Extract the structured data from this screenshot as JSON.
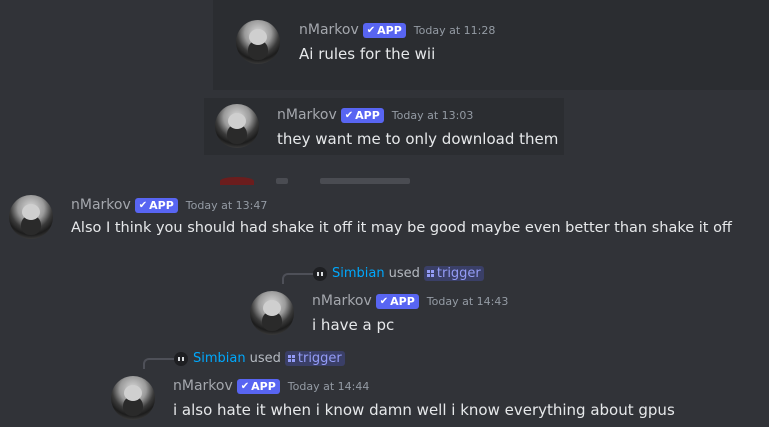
{
  "colors": {
    "background": "#313338",
    "badge": "#5865f2",
    "bot_name": "#00a8fc",
    "command": "#949cf7"
  },
  "messages": [
    {
      "username": "nMarkov",
      "badge": "APP",
      "timestamp": "Today at 11:28",
      "content": "Ai rules for the wii"
    },
    {
      "username": "nMarkov",
      "badge": "APP",
      "timestamp": "Today at 13:03",
      "content": "they want me to only download them"
    },
    {
      "username": "nMarkov",
      "badge": "APP",
      "timestamp": "Today at 13:47",
      "content": "Also I think you should had shake it off it may be good maybe even better than shake it off"
    },
    {
      "username": "nMarkov",
      "badge": "APP",
      "timestamp": "Today at 14:43",
      "content": "i have a pc",
      "reply": {
        "bot": "Simbian",
        "used": "used",
        "command": "trigger",
        "bot_icon": "robot-icon",
        "command_icon": "slash-command-icon"
      }
    },
    {
      "username": "nMarkov",
      "badge": "APP",
      "timestamp": "Today at 14:44",
      "content": "i also hate it when i know damn well i know everything about gpus",
      "reply": {
        "bot": "Simbian",
        "used": "used",
        "command": "trigger",
        "bot_icon": "robot-icon",
        "command_icon": "slash-command-icon"
      }
    }
  ]
}
